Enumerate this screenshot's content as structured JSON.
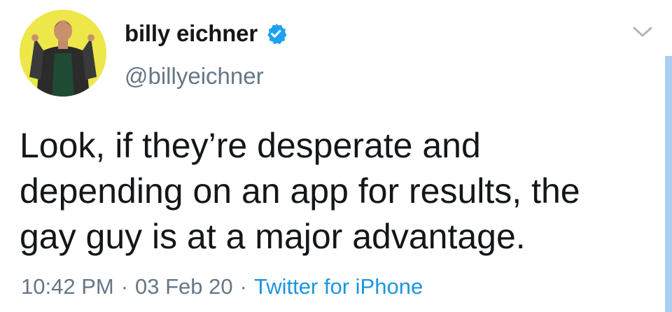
{
  "author": {
    "display_name": "billy eichner",
    "handle": "@billyeichner",
    "verified_icon": "verified-badge-icon",
    "avatar_icon": "profile-avatar"
  },
  "tweet": {
    "text": "Look, if they’re desperate and\ndepending on an app for results, the\ngay guy is at a major advantage."
  },
  "meta": {
    "time": "10:42 PM",
    "separator": "·",
    "date": "03 Feb 20",
    "source": "Twitter for iPhone"
  },
  "menu_icon": "chevron-down-icon",
  "colors": {
    "text": "#14171a",
    "secondary": "#657786",
    "link": "#1b95e0",
    "verified": "#1da1f2",
    "avatar_bg": "#ede74a",
    "scrollbar": "#a9cff0"
  }
}
